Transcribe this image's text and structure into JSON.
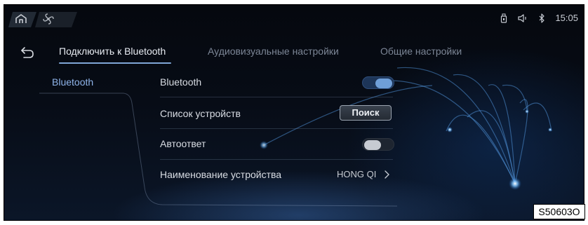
{
  "status_bar": {
    "time": "15:05",
    "icons": [
      "usb-drive-icon",
      "volume-icon",
      "bluetooth-icon"
    ]
  },
  "top_tabs": [
    "home-icon",
    "fan-icon"
  ],
  "tabs": [
    {
      "label": "Подключить к Bluetooth",
      "active": true
    },
    {
      "label": "Аудиовизуальные настройки",
      "active": false
    },
    {
      "label": "Общие настройки",
      "active": false
    }
  ],
  "sidebar": {
    "items": [
      {
        "label": "Bluetooth",
        "selected": true
      }
    ]
  },
  "settings": {
    "bluetooth": {
      "label": "Bluetooth",
      "enabled": true
    },
    "device_list": {
      "label": "Список устройств",
      "button_label": "Поиск"
    },
    "auto_answer": {
      "label": "Автоответ",
      "enabled": false
    },
    "device_name": {
      "label": "Наименование устройства",
      "value": "HONG QI"
    }
  },
  "figure_code": "S50603O",
  "colors": {
    "accent": "#7fa6d6",
    "selected_text": "#8fb4ea",
    "background": "#070c16",
    "toggle_on": "#6f9fd8"
  }
}
